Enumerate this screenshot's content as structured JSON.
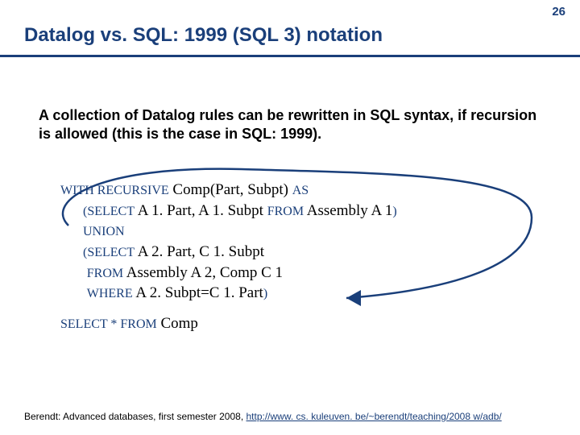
{
  "page_number": "26",
  "title": "Datalog vs. SQL: 1999 (SQL 3) notation",
  "intro": "A collection of Datalog rules can be rewritten in SQL syntax, if recursion is allowed (this is the case in SQL: 1999).",
  "kw": {
    "with_recursive": "WITH RECURSIVE",
    "as": "AS",
    "select1_open": "(SELECT",
    "from": "FROM",
    "close": ")",
    "union": "UNION",
    "where": "WHERE",
    "select_star_from": "SELECT * FROM"
  },
  "txt": {
    "comp_decl": " Comp(Part, Subpt) ",
    "sel1_cols": " A 1. Part, A 1. Subpt ",
    "sel1_from": " Assembly A 1",
    "sel2_cols": " A 2. Part, C 1. Subpt",
    "sel2_from": " Assembly A 2, Comp C 1",
    "sel2_where": " A 2. Subpt=C 1. Part",
    "final_from": " Comp"
  },
  "footer": {
    "prefix": "Berendt: Advanced databases, first semester 2008, ",
    "link": "http://www. cs. kuleuven. be/~berendt/teaching/2008 w/adb/"
  },
  "colors": {
    "accent": "#1a3f7a"
  }
}
